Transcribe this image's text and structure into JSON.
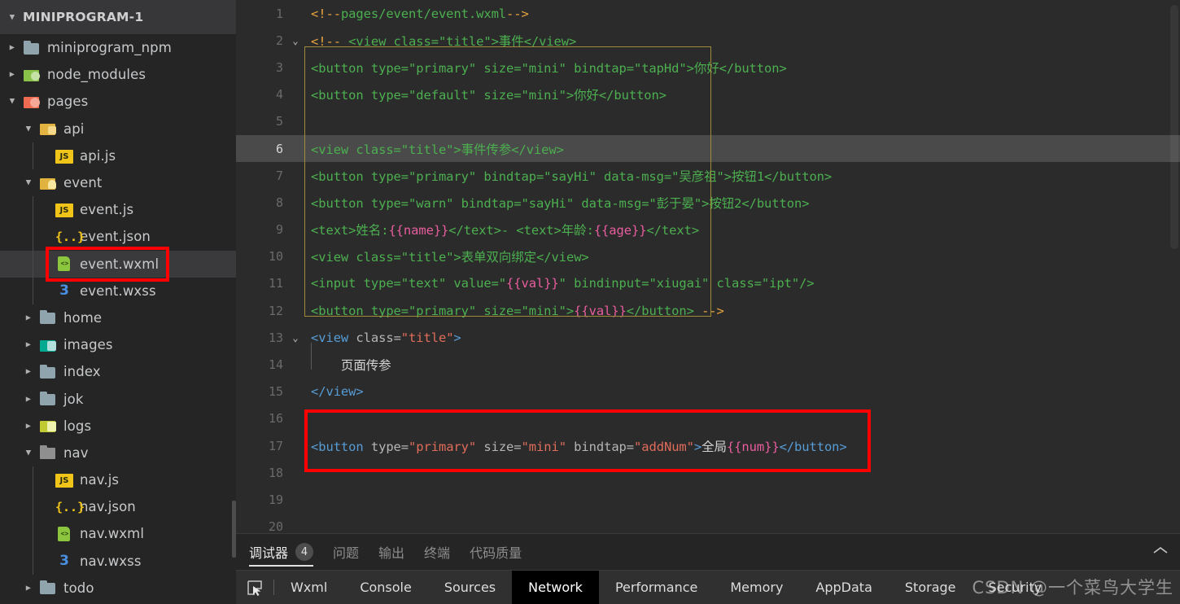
{
  "sidebar": {
    "header": {
      "label": "MINIPROGRAM-1",
      "twisty": "chevron-down-icon"
    },
    "items": [
      {
        "label": "miniprogram_npm",
        "type": "folder",
        "icon": "folder-grey-icon",
        "depth": 1,
        "twisty": "right",
        "iconclass": "folder-grey"
      },
      {
        "label": "node_modules",
        "type": "folder",
        "icon": "folder-green-icon",
        "depth": 1,
        "twisty": "right",
        "iconclass": "folder-green"
      },
      {
        "label": "pages",
        "type": "folder",
        "icon": "folder-red-icon",
        "depth": 1,
        "twisty": "down",
        "iconclass": "folder-red"
      },
      {
        "label": "api",
        "type": "folder",
        "icon": "folder-yellow-icon",
        "depth": 2,
        "twisty": "down",
        "iconclass": "folder-yellow"
      },
      {
        "label": "api.js",
        "type": "file",
        "icon": "js-file-icon",
        "depth": 3,
        "twisty": "none",
        "iconclass": "js",
        "glyph": "JS"
      },
      {
        "label": "event",
        "type": "folder",
        "icon": "folder-bell-icon",
        "depth": 2,
        "twisty": "down",
        "iconclass": "folder-bell"
      },
      {
        "label": "event.js",
        "type": "file",
        "icon": "js-file-icon",
        "depth": 3,
        "twisty": "none",
        "iconclass": "js",
        "glyph": "JS"
      },
      {
        "label": "event.json",
        "type": "file",
        "icon": "json-file-icon",
        "depth": 3,
        "twisty": "none",
        "iconclass": "json",
        "glyph": "{..}"
      },
      {
        "label": "event.wxml",
        "type": "file",
        "icon": "wxml-file-icon",
        "depth": 3,
        "twisty": "none",
        "iconclass": "wxml",
        "selected": true,
        "highlighted": true
      },
      {
        "label": "event.wxss",
        "type": "file",
        "icon": "wxss-file-icon",
        "depth": 3,
        "twisty": "none",
        "iconclass": "wxss",
        "glyph": "3"
      },
      {
        "label": "home",
        "type": "folder",
        "icon": "folder-grey-icon",
        "depth": 2,
        "twisty": "right",
        "iconclass": "folder-grey"
      },
      {
        "label": "images",
        "type": "folder",
        "icon": "folder-teal-icon",
        "depth": 2,
        "twisty": "right",
        "iconclass": "folder-teal"
      },
      {
        "label": "index",
        "type": "folder",
        "icon": "folder-grey-icon",
        "depth": 2,
        "twisty": "right",
        "iconclass": "folder-grey"
      },
      {
        "label": "jok",
        "type": "folder",
        "icon": "folder-grey-icon",
        "depth": 2,
        "twisty": "right",
        "iconclass": "folder-grey"
      },
      {
        "label": "logs",
        "type": "folder",
        "icon": "folder-olive-icon",
        "depth": 2,
        "twisty": "right",
        "iconclass": "folder-olive"
      },
      {
        "label": "nav",
        "type": "folder",
        "icon": "folder-plain-icon",
        "depth": 2,
        "twisty": "down",
        "iconclass": "folder-plain"
      },
      {
        "label": "nav.js",
        "type": "file",
        "icon": "js-file-icon",
        "depth": 3,
        "twisty": "none",
        "iconclass": "js",
        "glyph": "JS"
      },
      {
        "label": "nav.json",
        "type": "file",
        "icon": "json-file-icon",
        "depth": 3,
        "twisty": "none",
        "iconclass": "json",
        "glyph": "{..}"
      },
      {
        "label": "nav.wxml",
        "type": "file",
        "icon": "wxml-file-icon",
        "depth": 3,
        "twisty": "none",
        "iconclass": "wxml"
      },
      {
        "label": "nav.wxss",
        "type": "file",
        "icon": "wxss-file-icon",
        "depth": 3,
        "twisty": "none",
        "iconclass": "wxss",
        "glyph": "3"
      },
      {
        "label": "todo",
        "type": "folder",
        "icon": "folder-grey-icon",
        "depth": 2,
        "twisty": "right",
        "iconclass": "folder-grey"
      }
    ]
  },
  "editor": {
    "filename": "event.wxml",
    "current_line": 6,
    "highlighted_line": 17,
    "lines": [
      {
        "n": 1,
        "fold": "",
        "raw": "<!--pages/event/event.wxml-->"
      },
      {
        "n": 2,
        "fold": "⌄",
        "raw": "<!-- <view class=\"title\">事件</view>"
      },
      {
        "n": 3,
        "fold": "",
        "raw": "<button type=\"primary\" size=\"mini\" bindtap=\"tapHd\">你好</button>"
      },
      {
        "n": 4,
        "fold": "",
        "raw": "<button type=\"default\" size=\"mini\">你好</button>"
      },
      {
        "n": 5,
        "fold": "",
        "raw": ""
      },
      {
        "n": 6,
        "fold": "",
        "raw": "<view class=\"title\">事件传参</view>"
      },
      {
        "n": 7,
        "fold": "",
        "raw": "<button type=\"primary\" bindtap=\"sayHi\" data-msg=\"吴彦祖\">按钮1</button>"
      },
      {
        "n": 8,
        "fold": "",
        "raw": "<button type=\"warn\" bindtap=\"sayHi\" data-msg=\"彭于晏\">按钮2</button>"
      },
      {
        "n": 9,
        "fold": "",
        "raw": "<text>姓名:{{name}}</text>- <text>年龄:{{age}}</text>"
      },
      {
        "n": 10,
        "fold": "",
        "raw": "<view class=\"title\">表单双向绑定</view>"
      },
      {
        "n": 11,
        "fold": "",
        "raw": "<input type=\"text\" value=\"{{val}}\" bindinput=\"xiugai\" class=\"ipt\"/>"
      },
      {
        "n": 12,
        "fold": "",
        "raw": "<button type=\"primary\" size=\"mini\">{{val}}</button> -->"
      },
      {
        "n": 13,
        "fold": "⌄",
        "raw": "<view class=\"title\">"
      },
      {
        "n": 14,
        "fold": "",
        "raw": "    页面传参"
      },
      {
        "n": 15,
        "fold": "",
        "raw": "</view>"
      },
      {
        "n": 16,
        "fold": "",
        "raw": ""
      },
      {
        "n": 17,
        "fold": "",
        "raw": "<button type=\"primary\" size=\"mini\" bindtap=\"addNum\">全局{{num}}</button>"
      },
      {
        "n": 18,
        "fold": "",
        "raw": ""
      },
      {
        "n": 19,
        "fold": "",
        "raw": ""
      },
      {
        "n": 20,
        "fold": "",
        "raw": ""
      }
    ]
  },
  "panel": {
    "tabs": [
      {
        "label": "调试器",
        "active": true,
        "badge": "4"
      },
      {
        "label": "问题",
        "active": false,
        "badge": ""
      },
      {
        "label": "输出",
        "active": false,
        "badge": ""
      },
      {
        "label": "终端",
        "active": false,
        "badge": ""
      },
      {
        "label": "代码质量",
        "active": false,
        "badge": ""
      }
    ],
    "collapse_icon": "chevron-up-icon",
    "inspect_icon": "inspect-element-icon",
    "devtools_tabs": [
      {
        "label": "Wxml",
        "active": false
      },
      {
        "label": "Console",
        "active": false
      },
      {
        "label": "Sources",
        "active": false
      },
      {
        "label": "Network",
        "active": true
      },
      {
        "label": "Performance",
        "active": false
      },
      {
        "label": "Memory",
        "active": false
      },
      {
        "label": "AppData",
        "active": false
      },
      {
        "label": "Storage",
        "active": false
      },
      {
        "label": "Security",
        "active": false
      }
    ]
  },
  "watermark": {
    "text": "CSDN @一个菜鸟大学生"
  },
  "colors": {
    "sidebar_bg": "#252526",
    "editor_bg": "#2b2b2b",
    "selection": "#3a3a3a",
    "annotation_red": "#ff0000",
    "tag_blue": "#569cd6",
    "string_red": "#e06c5a",
    "comment_green": "#4caf50",
    "comment_orange": "#e8a33d",
    "interpolation_pink": "#e85d9e",
    "active_devtab_bg": "#000000"
  }
}
